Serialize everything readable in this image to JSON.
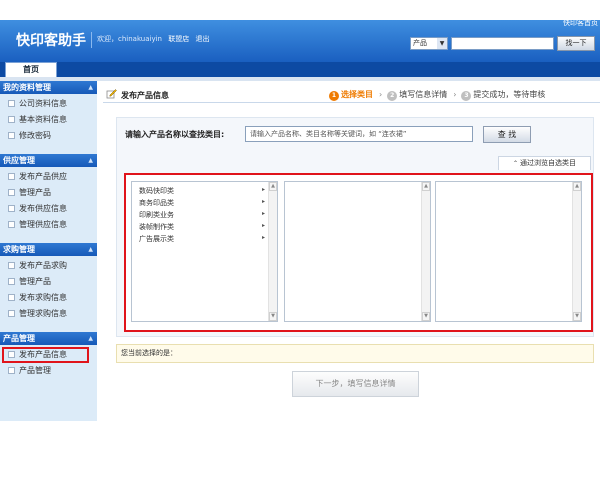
{
  "header": {
    "help_link": "快印客首页",
    "logo": "快印客助手",
    "welcome_prefix": "欢迎，chinakuaiyin",
    "link_shop": "联盟店",
    "link_logout": "退出",
    "search_select": "产品",
    "search_button": "找一下"
  },
  "nav": {
    "home_tab": "首页"
  },
  "sidebar": {
    "sections": [
      {
        "title": "我的资料管理",
        "items": [
          "公司资料信息",
          "基本资料信息",
          "修改密码"
        ]
      },
      {
        "title": "供应管理",
        "items": [
          "发布产品供应",
          "管理产品",
          "发布供应信息",
          "管理供应信息"
        ]
      },
      {
        "title": "求购管理",
        "items": [
          "发布产品求购",
          "管理产品",
          "发布求购信息",
          "管理求购信息"
        ]
      },
      {
        "title": "产品管理",
        "items": [
          "发布产品信息",
          "产品管理"
        ]
      }
    ]
  },
  "main": {
    "title": "发布产品信息",
    "steps": [
      {
        "num": "1",
        "label": "选择类目"
      },
      {
        "num": "2",
        "label": "填写信息详情"
      },
      {
        "num": "3",
        "label": "提交成功，等待审核"
      }
    ],
    "find_label": "请输入产品名称以查找类目:",
    "find_placeholder": "请输入产品名称、类目名称等关键词，如 “连衣裙”",
    "find_button": "查 找",
    "browse_tab": "通过浏览自选类目",
    "categories": [
      "数码快印类",
      "商务印品类",
      "印刷类业务",
      "装帧制作类",
      "广告展示类"
    ],
    "selected_label": "您当前选择的是：",
    "next_button": "下一步，填写信息详情"
  },
  "colors": {
    "accent_red": "#e0141b",
    "step_active": "#ef7b00",
    "header_blue": "#1a5fc0"
  }
}
